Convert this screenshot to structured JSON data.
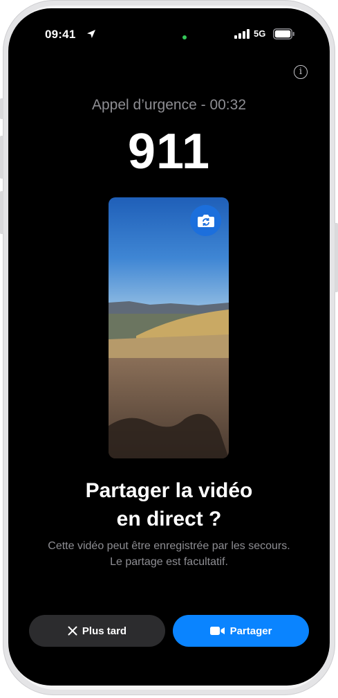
{
  "status_bar": {
    "time": "09:41",
    "network": "5G"
  },
  "call": {
    "status": "Appel d’urgence - 00:32",
    "number": "911"
  },
  "prompt": {
    "title_line1": "Partager la vidéo",
    "title_line2": "en direct ?",
    "subtitle_line1": "Cette vidéo peut être enregistrée par les secours.",
    "subtitle_line2": "Le partage est facultatif."
  },
  "buttons": {
    "later_label": "Plus tard",
    "share_label": "Partager"
  },
  "icons": {
    "location": "location-arrow-icon",
    "info": "info-icon",
    "flip_camera": "camera-flip-icon",
    "close": "close-icon",
    "video": "video-camera-icon"
  },
  "colors": {
    "accent": "#0a84ff",
    "secondary_button": "#2c2c2e",
    "camera_indicator": "#34c759"
  }
}
